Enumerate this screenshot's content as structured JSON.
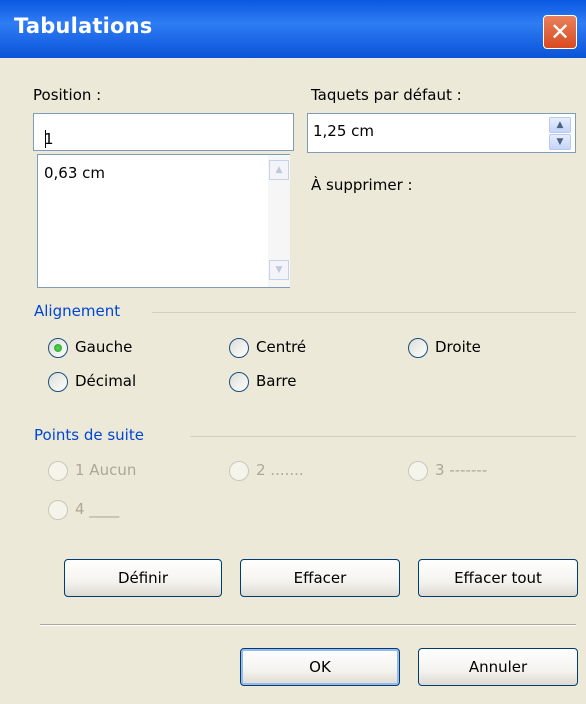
{
  "window": {
    "title": "Tabulations",
    "close_glyph": "✕"
  },
  "position": {
    "label": "Position :",
    "value": "1",
    "list_items": [
      "0,63 cm"
    ]
  },
  "default_tabs": {
    "label": "Taquets par défaut :",
    "value": "1,25 cm"
  },
  "to_clear": {
    "label": "À supprimer :"
  },
  "alignment": {
    "title": "Alignement",
    "options": [
      {
        "label": "Gauche",
        "checked": true
      },
      {
        "label": "Centré",
        "checked": false
      },
      {
        "label": "Droite",
        "checked": false
      },
      {
        "label": "Décimal",
        "checked": false
      },
      {
        "label": "Barre",
        "checked": false
      }
    ]
  },
  "leader": {
    "title": "Points de suite",
    "options": [
      {
        "label": "1 Aucun",
        "enabled": false
      },
      {
        "label": "2 .......",
        "enabled": false
      },
      {
        "label": "3 -------",
        "enabled": false
      },
      {
        "label": "4 ____",
        "enabled": false
      }
    ]
  },
  "buttons": {
    "set": "Définir",
    "clear": "Effacer",
    "clear_all": "Effacer tout",
    "ok": "OK",
    "cancel": "Annuler"
  },
  "colors": {
    "title_bar": "#0a58e0",
    "group_title": "#0046d5",
    "radio_dot": "#21a121"
  },
  "icons": {
    "close": "close-icon",
    "scroll_up": "scroll-up-arrow-icon",
    "scroll_down": "scroll-down-arrow-icon",
    "spin_up": "spin-up-arrow-icon",
    "spin_down": "spin-down-arrow-icon"
  }
}
